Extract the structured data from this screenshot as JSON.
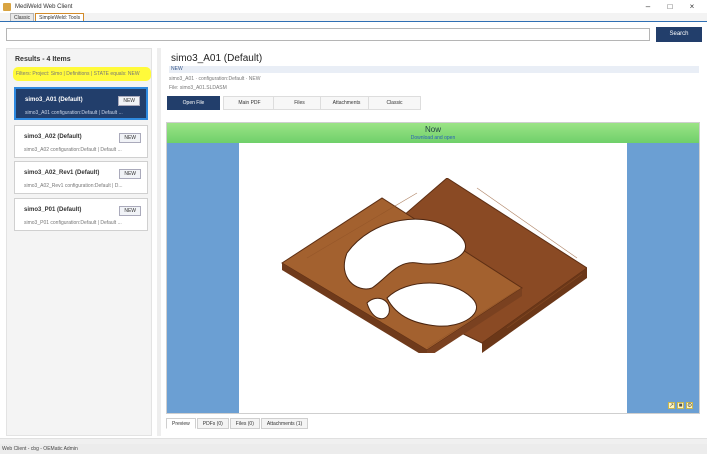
{
  "window": {
    "title": "MediWeld Web Client",
    "controls": [
      "–",
      "□",
      "×"
    ]
  },
  "tabs": [
    {
      "label": "Classic",
      "active": false
    },
    {
      "label": "SimpleWeld: Tools",
      "active": true
    }
  ],
  "search": {
    "value": "",
    "placeholder": "",
    "button_label": "Search"
  },
  "results": {
    "title": "Results - 4 Items",
    "filter_text": "Filters: Project: Simo | Definitions | STATE equals: NEW",
    "items": [
      {
        "title": "simo3_A01 (Default)",
        "sub": "simo3_A01 configuration:Default | Default ...",
        "badge": "NEW",
        "selected": true
      },
      {
        "title": "simo3_A02 (Default)",
        "sub": "simo3_A02 configuration:Default | Default ...",
        "badge": "NEW",
        "selected": false
      },
      {
        "title": "simo3_A02_Rev1 (Default)",
        "sub": "simo3_A02_Rev1 configuration:Default | D...",
        "badge": "NEW",
        "selected": false
      },
      {
        "title": "simo3_P01 (Default)",
        "sub": "simo3_P01 configuration:Default | Default ...",
        "badge": "NEW",
        "selected": false
      }
    ]
  },
  "detail": {
    "title": "simo3_A01 (Default)",
    "state": "NEW",
    "meta1": "simo3_A01 · configuration:Default · NEW",
    "meta2": "File: simo3_A01.SLDASM",
    "actions": [
      "Open File",
      "Main PDF",
      "Files",
      "Attachments",
      "Classic"
    ],
    "viewer": {
      "status": "Now",
      "link": "Download and open"
    },
    "bottom_tabs": [
      "Preview",
      "PDFs (0)",
      "Files (0)",
      "Attachments (1)"
    ]
  },
  "statusbar": {
    "left": "Web Client - cbg - OEMatic Admin",
    "right": ""
  },
  "icons": {
    "app": "app-logo-icon",
    "viewer_tools": [
      "expand-icon",
      "save-icon",
      "settings-icon"
    ]
  },
  "colors": {
    "accent": "#223e6b",
    "highlight": "#fffa3a",
    "viewer_side": "#6b9fd3",
    "viewer_green": "#7fd873",
    "wood": "#8a4a24"
  }
}
